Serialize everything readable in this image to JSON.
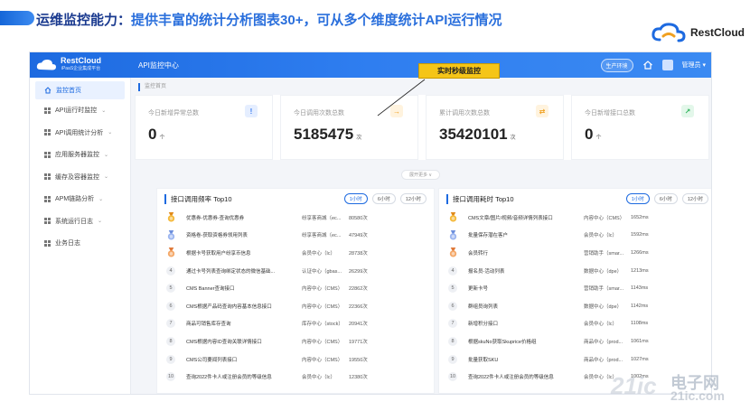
{
  "slide": {
    "title_main": "运维监控能力：",
    "title_sub": "提供丰富的统计分析图表30+，可从多个维度统计API运行情况",
    "brand_name": "RestCloud"
  },
  "topbar": {
    "logo_name": "RestCloud",
    "logo_tagline": "iPaaS企业集成平台",
    "title": "API监控中心",
    "env_label": "生产环境",
    "admin_label": "管理员 ▾"
  },
  "sidebar": {
    "items": [
      {
        "label": "监控首页",
        "active": true,
        "arrow": ""
      },
      {
        "label": "API运行时监控",
        "arrow": "⌄"
      },
      {
        "label": "API调用统计分析",
        "arrow": "⌄"
      },
      {
        "label": "应用服务器监控",
        "arrow": "⌄"
      },
      {
        "label": "缓存及容器监控",
        "arrow": "⌄"
      },
      {
        "label": "APM链路分析",
        "arrow": "⌄"
      },
      {
        "label": "系统运行日志",
        "arrow": "⌄"
      },
      {
        "label": "业务日志",
        "arrow": ""
      }
    ]
  },
  "breadcrumb": "监控首页",
  "callout": "实时秒级监控",
  "stats": [
    {
      "label": "今日新增异常总数",
      "value": "0",
      "unit": "个",
      "badge": "!",
      "badge_color": "#3a7cf0",
      "badge_bg": "#e5eeff"
    },
    {
      "label": "今日调用次数总数",
      "value": "5185475",
      "unit": "次",
      "badge": "→",
      "badge_color": "#f0a020",
      "badge_bg": "#fff3de"
    },
    {
      "label": "累计调用次数总数",
      "value": "35420101",
      "unit": "次",
      "badge": "⇄",
      "badge_color": "#f0a020",
      "badge_bg": "#fff3de"
    },
    {
      "label": "今日新增接口总数",
      "value": "0",
      "unit": "个",
      "badge": "↗",
      "badge_color": "#2db45a",
      "badge_bg": "#e3f7ea"
    }
  ],
  "more_label": "展开更多 ∨",
  "panels": {
    "left": {
      "title": "接口调用频率 Top10",
      "tabs": [
        "1小时",
        "6小时",
        "12小时"
      ],
      "rows": [
        {
          "rank": "1",
          "name": "优惠券-优惠券-查询优惠券",
          "sys": "纷享客商城（ec...",
          "count": "80580次"
        },
        {
          "rank": "2",
          "name": "资格卷-获取资格券领用列表",
          "sys": "纷享客商城（ec...",
          "count": "47949次"
        },
        {
          "rank": "3",
          "name": "根据卡号获取用户纷享币信息",
          "sys": "会员中心（lc）",
          "count": "28738次"
        },
        {
          "rank": "4",
          "name": "通过卡号列表查询绑定状态的微信基础...",
          "sys": "认证中心（gbas...",
          "count": "26299次"
        },
        {
          "rank": "5",
          "name": "CMS Banner查询接口",
          "sys": "内容中心（CMS）",
          "count": "22862次"
        },
        {
          "rank": "6",
          "name": "CMS根据产品码查询内容基本信息接口",
          "sys": "内容中心（CMS）",
          "count": "22366次"
        },
        {
          "rank": "7",
          "name": "商品可销售库存查询",
          "sys": "库存中心（stock）",
          "count": "20941次"
        },
        {
          "rank": "8",
          "name": "CMS根据内容ID查询关联详情接口",
          "sys": "内容中心（CMS）",
          "count": "19771次"
        },
        {
          "rank": "9",
          "name": "CMS公司要闻列表接口",
          "sys": "内容中心（CMS）",
          "count": "19550次"
        },
        {
          "rank": "10",
          "name": "查询2022件卡人或注册会员的等级信息",
          "sys": "会员中心（lc）",
          "count": "12380次"
        }
      ]
    },
    "right": {
      "title": "接口调用耗时 Top10",
      "tabs": [
        "1小时",
        "6小时",
        "12小时"
      ],
      "rows": [
        {
          "rank": "1",
          "name": "CMS文章/图片/视频/音频详情列表接口",
          "sys": "内容中心（CMS）",
          "count": "1652ms"
        },
        {
          "rank": "2",
          "name": "批量保存潜在客户",
          "sys": "会员中心（lc）",
          "count": "1592ms"
        },
        {
          "rank": "3",
          "name": "会员转行",
          "sys": "营销助手（smar...",
          "count": "1266ms"
        },
        {
          "rank": "4",
          "name": "报名员-活动列表",
          "sys": "数据中心（dpe）",
          "count": "1213ms"
        },
        {
          "rank": "5",
          "name": "更新卡号",
          "sys": "营销助手（smar...",
          "count": "1143ms"
        },
        {
          "rank": "6",
          "name": "群组员询列表",
          "sys": "数据中心（dpe）",
          "count": "1142ms"
        },
        {
          "rank": "7",
          "name": "新增积分接口",
          "sys": "会员中心（lc）",
          "count": "1108ms"
        },
        {
          "rank": "8",
          "name": "根据skuNo获取Skuprice价格组",
          "sys": "商品中心（prod...",
          "count": "1061ms"
        },
        {
          "rank": "9",
          "name": "批量获取SKU",
          "sys": "商品中心（prod...",
          "count": "1027ms"
        },
        {
          "rank": "10",
          "name": "查询2022件卡人或注册会员的等级信息",
          "sys": "会员中心（lc）",
          "count": "1002ms"
        }
      ]
    }
  },
  "watermark": {
    "text": "电子网",
    "prefix": "21ic",
    "url": "21ic.com"
  },
  "icons": {
    "brand_logo": "cloud-logo-icon",
    "home": "home-icon",
    "menu": "grid-icon",
    "medal_gold": "gold-medal-icon",
    "medal_silver": "silver-medal-icon",
    "medal_bronze": "bronze-medal-icon"
  }
}
